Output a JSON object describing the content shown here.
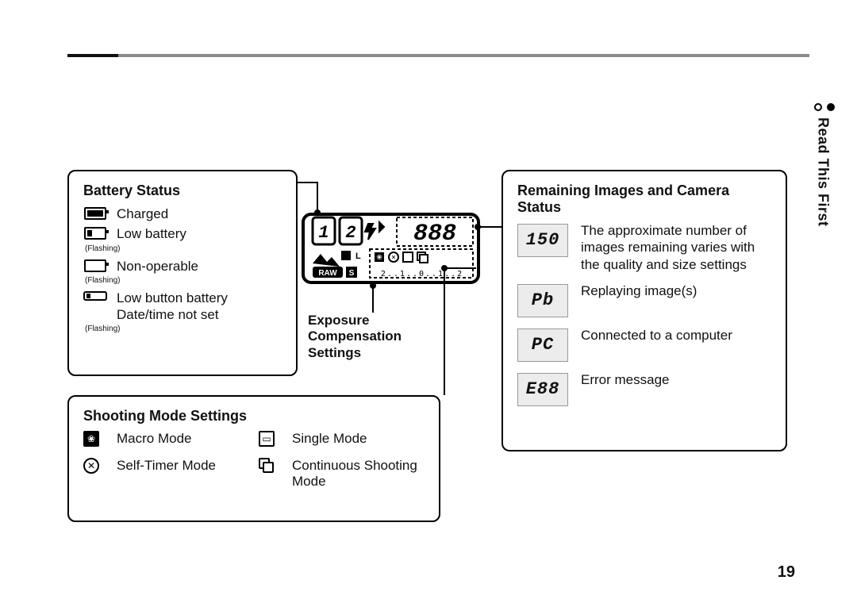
{
  "sidetab": {
    "label": "Read This First"
  },
  "page_number": "19",
  "battery": {
    "title": "Battery Status",
    "charged": "Charged",
    "low": "Low battery",
    "nonop": "Non-operable",
    "button_low": "Low button battery Date/time not set",
    "flashing": "(Flashing)"
  },
  "shooting": {
    "title": "Shooting Mode Settings",
    "macro": "Macro Mode",
    "single": "Single Mode",
    "selftimer": "Self-Timer Mode",
    "continuous": "Continuous Shooting Mode"
  },
  "exposure": {
    "title": "Exposure Compensation Settings"
  },
  "remaining": {
    "title": "Remaining Images and Camera Status",
    "count_value": "150",
    "count_desc": "The approximate number of images remaining varies with the quality and size settings",
    "pb_value": "Pb",
    "pb_desc": "Replaying image(s)",
    "pc_value": "PC",
    "pc_desc": "Connected to a computer",
    "err_value": "E88",
    "err_desc": "Error message"
  },
  "lcd": {
    "box1": "1",
    "box2": "2",
    "count": "888",
    "raw": "RAW",
    "l": "L",
    "s": "S",
    "scale": "2..1..0..1..2"
  }
}
